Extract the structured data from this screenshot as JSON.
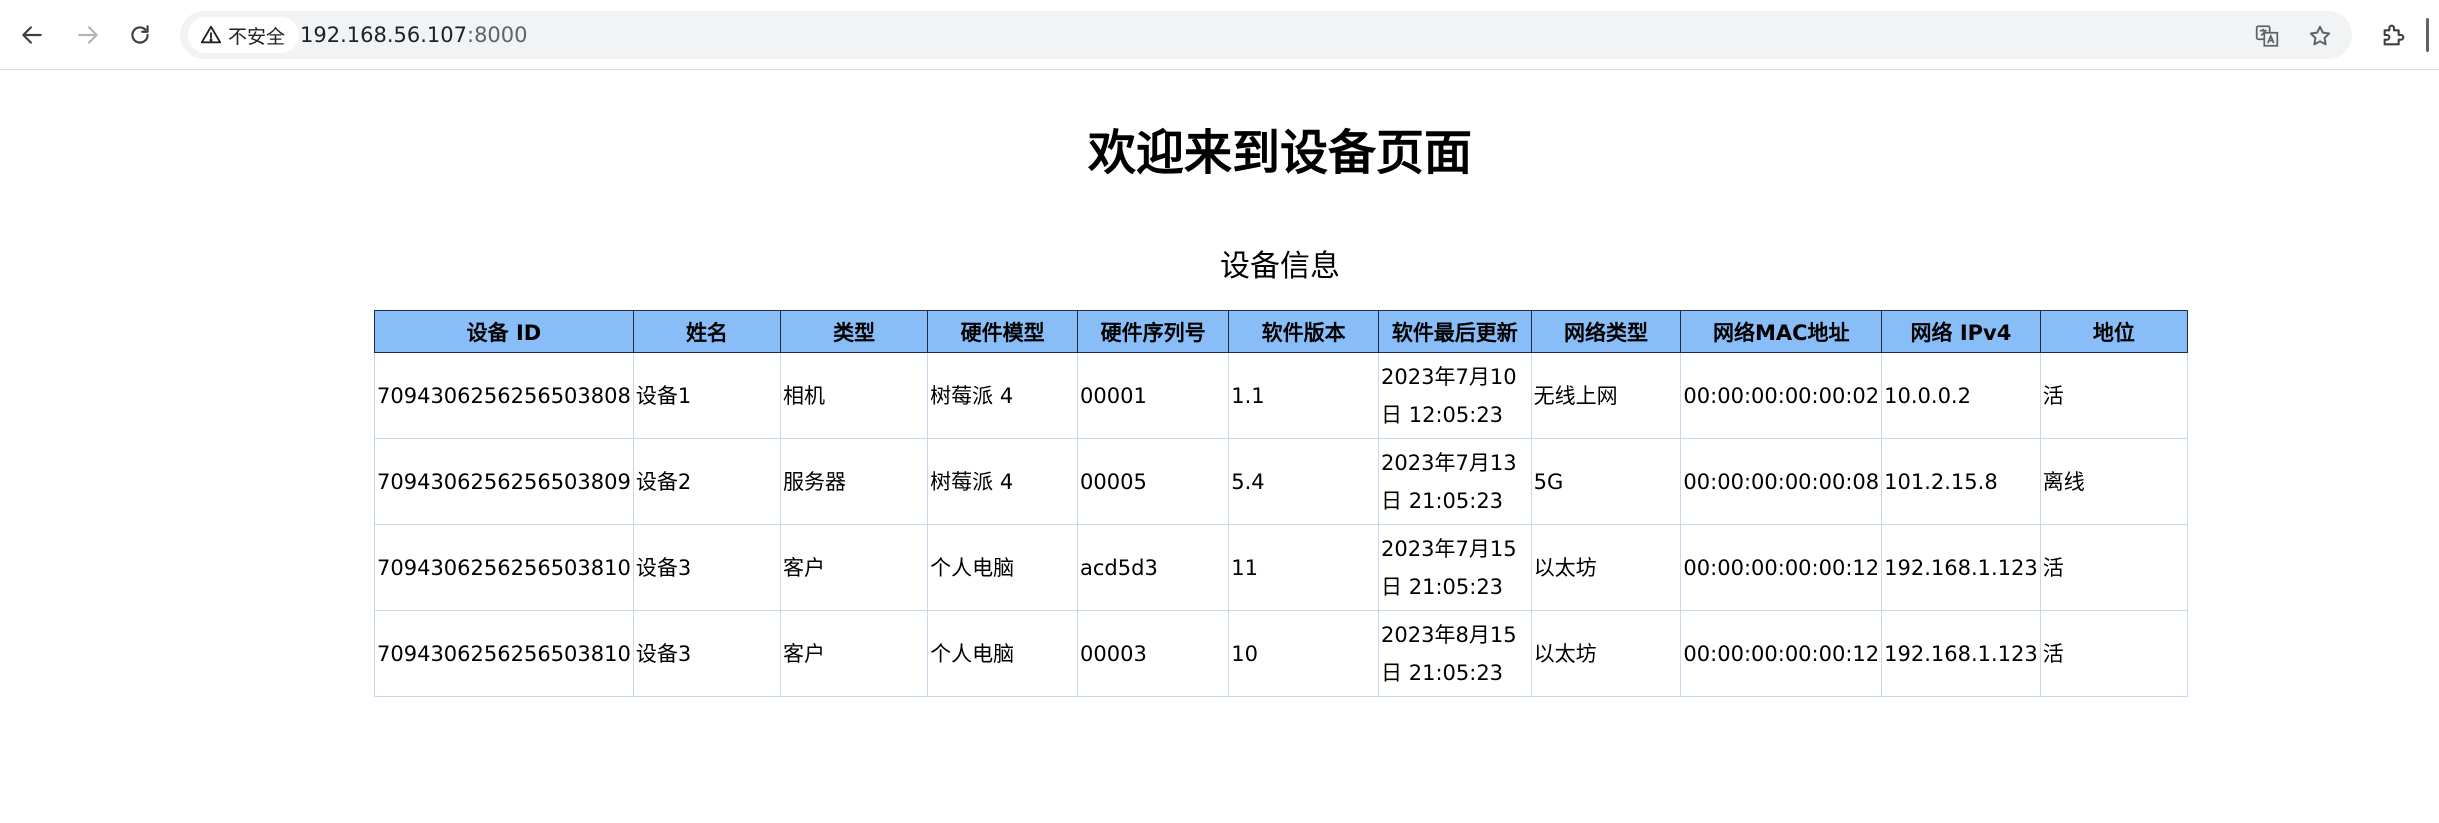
{
  "browser": {
    "security_label": "不安全",
    "url_host": "192.168.56.107",
    "url_port": ":8000",
    "icons": [
      "back-arrow-icon",
      "forward-arrow-icon",
      "reload-icon",
      "warning-icon",
      "translate-icon",
      "star-icon",
      "extensions-icon"
    ]
  },
  "page": {
    "title": "欢迎来到设备页面",
    "section_title": "设备信息"
  },
  "table": {
    "header_color": "#88bdf7",
    "headers": [
      "设备 ID",
      "姓名",
      "类型",
      "硬件模型",
      "硬件序列号",
      "软件版本",
      "软件最后更新",
      "网络类型",
      "网络MAC地址",
      "网络 IPv4",
      "地位"
    ],
    "rows": [
      [
        "7094306256256503808",
        "设备1",
        "相机",
        "树莓派 4",
        "00001",
        "1.1",
        "2023年7月10日 12:05:23",
        "无线上网",
        "00:00:00:00:00:02",
        "10.0.0.2",
        "活"
      ],
      [
        "7094306256256503809",
        "设备2",
        "服务器",
        "树莓派 4",
        "00005",
        "5.4",
        "2023年7月13日 21:05:23",
        "5G",
        "00:00:00:00:00:08",
        "101.2.15.8",
        "离线"
      ],
      [
        "7094306256256503810",
        "设备3",
        "客户",
        "个人电脑",
        "acd5d3",
        "11",
        "2023年7月15日 21:05:23",
        "以太坊",
        "00:00:00:00:00:12",
        "192.168.1.123",
        "活"
      ],
      [
        "7094306256256503810",
        "设备3",
        "客户",
        "个人电脑",
        "00003",
        "10",
        "2023年8月15日 21:05:23",
        "以太坊",
        "00:00:00:00:00:12",
        "192.168.1.123",
        "活"
      ]
    ]
  }
}
